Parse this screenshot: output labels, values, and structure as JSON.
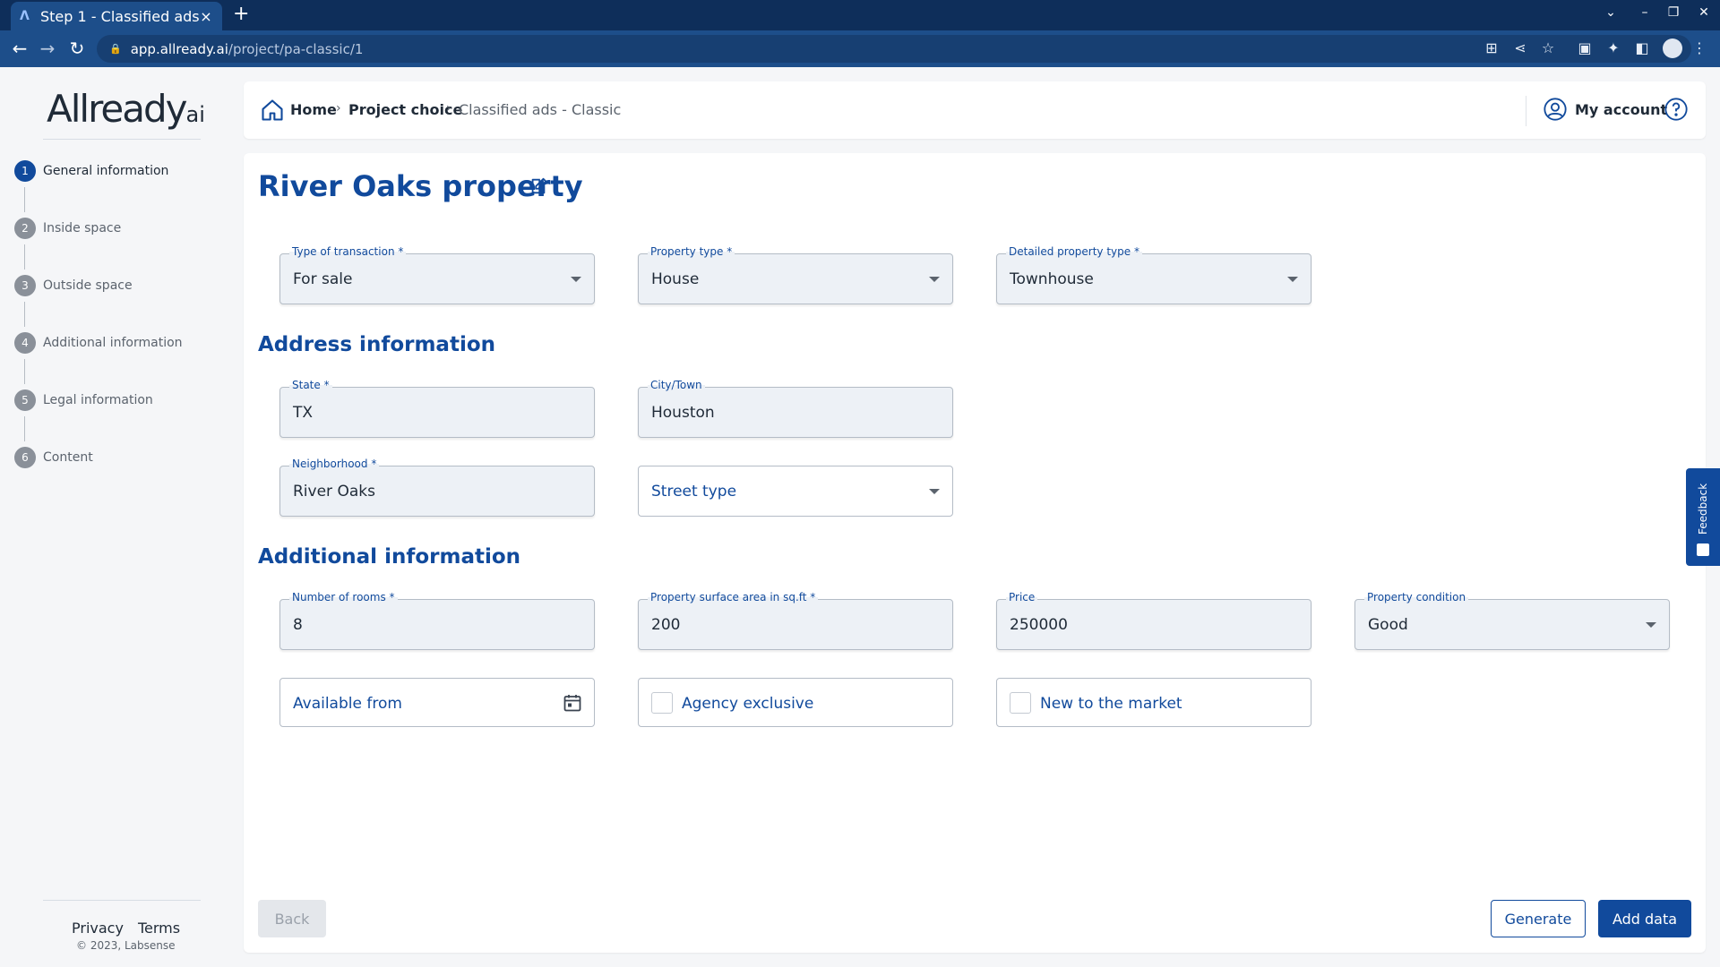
{
  "browser": {
    "tab_title": "Step 1 - Classified ads - Classic",
    "url_host": "app.allready.ai",
    "url_path": "/project/pa-classic/1"
  },
  "sidebar": {
    "brand": "Allready",
    "brand_sub": "ai",
    "steps": [
      {
        "num": "1",
        "label": "General information"
      },
      {
        "num": "2",
        "label": "Inside space"
      },
      {
        "num": "3",
        "label": "Outside space"
      },
      {
        "num": "4",
        "label": "Additional information"
      },
      {
        "num": "5",
        "label": "Legal information"
      },
      {
        "num": "6",
        "label": "Content"
      }
    ],
    "privacy": "Privacy",
    "terms": "Terms",
    "copyright": "© 2023, Labsense"
  },
  "header": {
    "home": "Home",
    "project_choice": "Project choice",
    "current": "Classified ads - Classic",
    "account": "My account"
  },
  "main": {
    "title": "River Oaks property",
    "section_address": "Address information",
    "section_additional": "Additional information",
    "fields": {
      "transaction_label": "Type of transaction *",
      "transaction_value": "For sale",
      "property_type_label": "Property type *",
      "property_type_value": "House",
      "detailed_type_label": "Detailed property type *",
      "detailed_type_value": "Townhouse",
      "state_label": "State *",
      "state_value": "TX",
      "city_label": "City/Town",
      "city_value": "Houston",
      "neighborhood_label": "Neighborhood *",
      "neighborhood_value": "River Oaks",
      "street_type_placeholder": "Street type",
      "rooms_label": "Number of rooms *",
      "rooms_value": "8",
      "surface_label": "Property surface area in sq.ft *",
      "surface_value": "200",
      "price_label": "Price",
      "price_value": "250000",
      "condition_label": "Property condition",
      "condition_value": "Good",
      "available_from_placeholder": "Available from",
      "agency_exclusive": "Agency exclusive",
      "new_to_market": "New to the market"
    },
    "buttons": {
      "back": "Back",
      "generate": "Generate",
      "add_data": "Add data"
    }
  },
  "feedback": "Feedback",
  "colors": {
    "brand_blue": "#114a9c",
    "chrome_dark": "#0e2e5a",
    "chrome": "#1d4e8a"
  }
}
